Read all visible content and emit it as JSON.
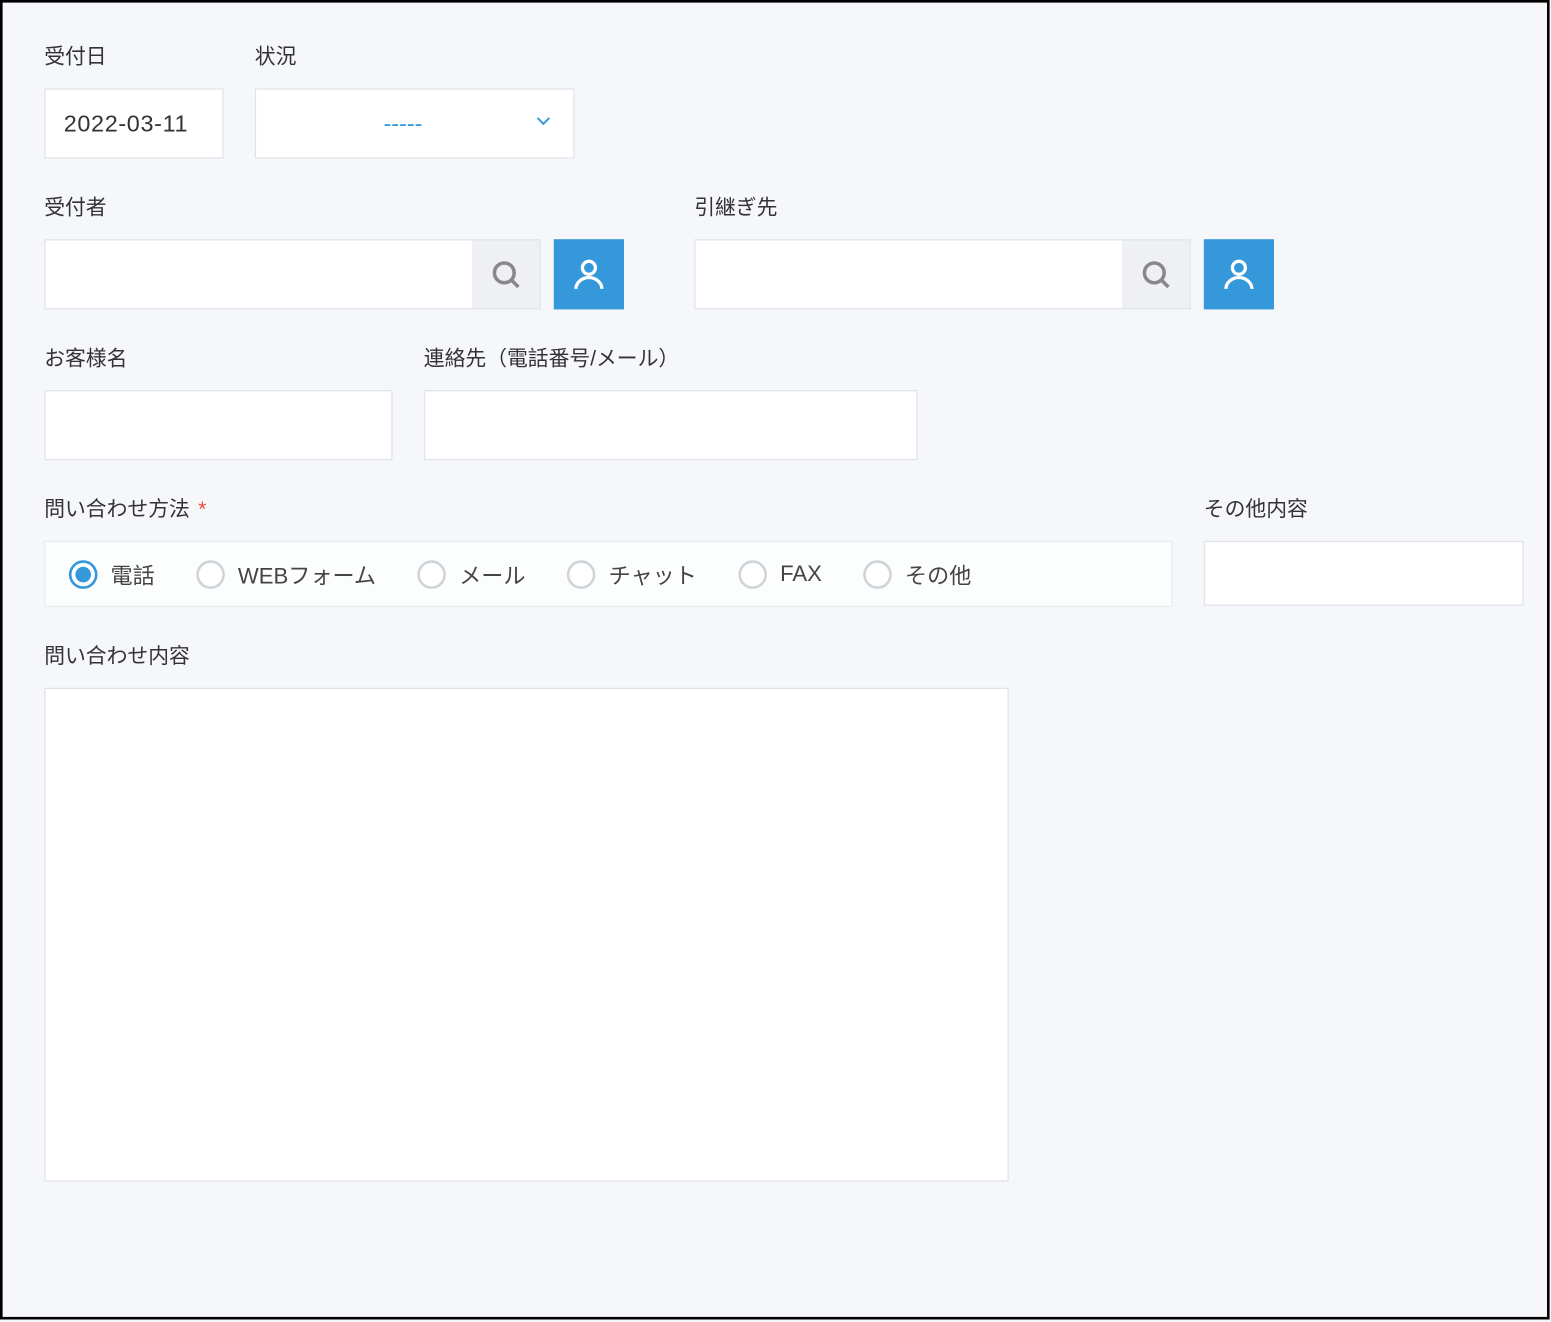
{
  "form": {
    "reception_date": {
      "label": "受付日",
      "value": "2022-03-11"
    },
    "status": {
      "label": "状況",
      "value": "-----"
    },
    "receiver": {
      "label": "受付者",
      "value": ""
    },
    "handoff": {
      "label": "引継ぎ先",
      "value": ""
    },
    "customer_name": {
      "label": "お客様名",
      "value": ""
    },
    "contact_info": {
      "label": "連絡先（電話番号/メール）",
      "value": ""
    },
    "inquiry_method": {
      "label": "問い合わせ方法",
      "required": "*",
      "options": [
        {
          "label": "電話",
          "checked": true
        },
        {
          "label": "WEBフォーム",
          "checked": false
        },
        {
          "label": "メール",
          "checked": false
        },
        {
          "label": "チャット",
          "checked": false
        },
        {
          "label": "FAX",
          "checked": false
        },
        {
          "label": "その他",
          "checked": false
        }
      ]
    },
    "other_content": {
      "label": "その他内容",
      "value": ""
    },
    "inquiry_content": {
      "label": "問い合わせ内容",
      "value": ""
    }
  }
}
